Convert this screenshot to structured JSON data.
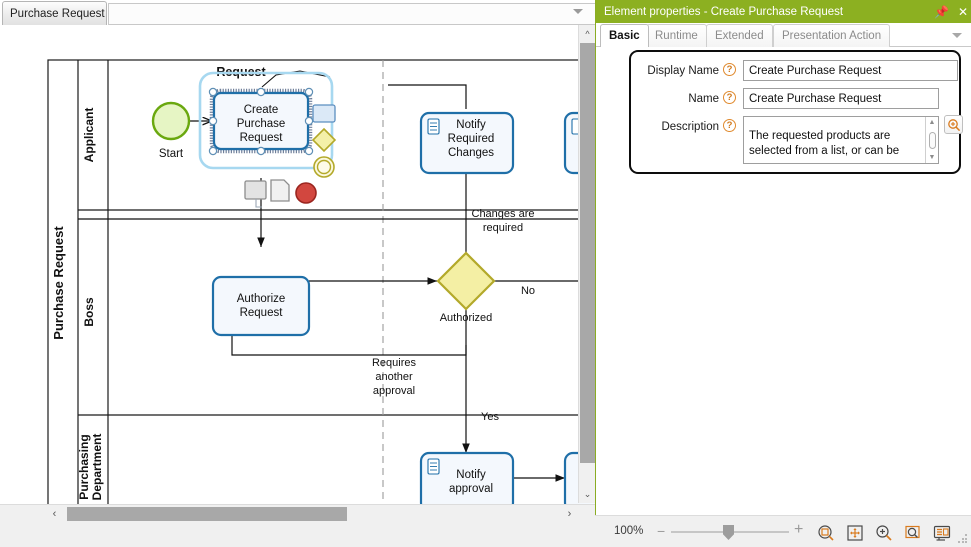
{
  "editor": {
    "document_tab": "Purchase Request",
    "tab_dropdown_icon": "chevron-down-icon"
  },
  "diagram": {
    "pool_label": "Purchase Request",
    "lanes": [
      {
        "id": "applicant",
        "label": "Applicant"
      },
      {
        "id": "boss",
        "label": "Boss"
      },
      {
        "id": "purchasing",
        "label": "Purchasing Department"
      }
    ],
    "nodes": [
      {
        "id": "start",
        "type": "start-event",
        "label": "Start"
      },
      {
        "id": "create-purchase-request",
        "type": "task",
        "label": "Create Purchase Request",
        "selected": true
      },
      {
        "id": "notify-required-changes",
        "type": "user-task",
        "label": "Notify Required Changes"
      },
      {
        "id": "authorize-request",
        "type": "task",
        "label": "Authorize Request"
      },
      {
        "id": "authorized-gateway",
        "type": "exclusive-gateway",
        "label": "Authorized"
      },
      {
        "id": "notify-approval",
        "type": "user-task",
        "label": "Notify approval"
      }
    ],
    "edge_labels": [
      {
        "id": "changes-required",
        "text_line1": "Changes are",
        "text_line2": "required"
      },
      {
        "id": "gateway-no",
        "text": "No"
      },
      {
        "id": "gateway-yes",
        "text": "Yes"
      },
      {
        "id": "requires-another-approval",
        "text_line1": "Requires",
        "text_line2": "another",
        "text_line3": "approval"
      },
      {
        "id": "request-annotation",
        "text": "Request"
      }
    ],
    "palette": [
      {
        "id": "task",
        "name": "task-shape-icon"
      },
      {
        "id": "gateway",
        "name": "gateway-shape-icon"
      },
      {
        "id": "intermediate-event",
        "name": "intermediate-event-icon"
      },
      {
        "id": "subprocess",
        "name": "subprocess-icon"
      },
      {
        "id": "document",
        "name": "document-icon"
      },
      {
        "id": "end-event",
        "name": "end-event-icon"
      }
    ],
    "colors": {
      "task_border": "#1f6fa8",
      "task_fill": "#f4f8fd",
      "start_event": "#7ab317",
      "end_event": "#c0392b",
      "gateway": "#f2ee9e",
      "gateway_border": "#b3a92a",
      "selection": "#9dd3ef"
    }
  },
  "properties": {
    "title": "Element properties - Create Purchase Request",
    "pin_icon": "pin-icon",
    "close_icon": "close-icon",
    "tabs": [
      {
        "id": "basic",
        "label": "Basic",
        "active": true
      },
      {
        "id": "runtime",
        "label": "Runtime",
        "active": false
      },
      {
        "id": "extended",
        "label": "Extended",
        "active": false
      },
      {
        "id": "presentation-action",
        "label": "Presentation Action",
        "active": false
      }
    ],
    "tabs_overflow_icon": "chevron-down-icon",
    "fields": [
      {
        "id": "display-name",
        "label": "Display Name",
        "help": "?",
        "value": "Create Purchase Request"
      },
      {
        "id": "name",
        "label": "Name",
        "help": "?",
        "value": "Create Purchase Request"
      },
      {
        "id": "description",
        "label": "Description",
        "help": "?",
        "value_line1": "The requested products are",
        "value_line2": "selected from a list, or can be",
        "expand_icon": "magnifier-plus-icon"
      }
    ]
  },
  "statusbar": {
    "zoom_level": "100%",
    "zoom_out_label": "−",
    "zoom_in_label": "+",
    "buttons": [
      {
        "id": "fit-page",
        "name": "fit-page-icon"
      },
      {
        "id": "fit-selection",
        "name": "fit-selection-icon"
      },
      {
        "id": "zoom-in",
        "name": "zoom-in-icon"
      },
      {
        "id": "zoom-area",
        "name": "zoom-area-icon"
      },
      {
        "id": "presentation-mode",
        "name": "presentation-mode-icon"
      }
    ]
  }
}
